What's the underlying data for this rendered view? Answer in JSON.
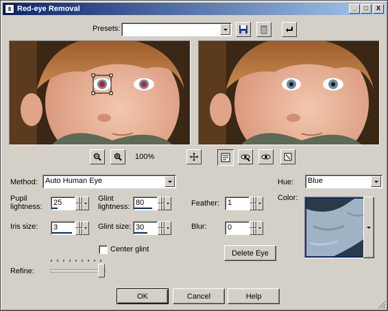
{
  "window": {
    "title": "Red-eye Removal",
    "app_icon_glyph": "8"
  },
  "titlebar": {
    "minimize": "_",
    "maximize": "□",
    "close": "X"
  },
  "presets": {
    "label": "Presets:",
    "value": ""
  },
  "zoom": {
    "level": "100%"
  },
  "method": {
    "label": "Method:",
    "value": "Auto Human Eye"
  },
  "pupil_lightness": {
    "label_line1": "Pupil",
    "label_line2": "lightness:",
    "value": "25",
    "level": 0.25
  },
  "glint_lightness": {
    "label_line1": "Glint",
    "label_line2": "lightness:",
    "value": "80",
    "level": 0.8
  },
  "iris_size": {
    "label": "Iris size:",
    "value": "3",
    "level": 0.9
  },
  "glint_size": {
    "label": "Glint size:",
    "value": "30",
    "level": 0.6
  },
  "feather": {
    "label": "Feather:",
    "value": "1",
    "level": 0.0
  },
  "blur": {
    "label": "Blur:",
    "value": "0",
    "level": 0.0
  },
  "center_glint": {
    "label": "Center glint",
    "checked": false
  },
  "delete_eye": {
    "label": "Delete Eye"
  },
  "hue": {
    "label": "Hue:",
    "value": "Blue"
  },
  "color": {
    "label": "Color:"
  },
  "refine": {
    "label": "Refine:",
    "level": 1.0
  },
  "buttons": {
    "ok": "OK",
    "cancel": "Cancel",
    "help": "Help"
  },
  "colors": {
    "titlebar_start": "#0a246a",
    "titlebar_end": "#a6caf0",
    "face": "#d4d0c8",
    "iris_swatch": "#9fb3c5"
  },
  "icons": {
    "save": "floppy-icon",
    "delete": "trash-icon",
    "reset": "undo-arrow-icon",
    "zoom_out": "zoom-out-icon",
    "zoom_in": "zoom-in-icon",
    "pan": "pan-icon",
    "proof": "proof-icon",
    "eye_tool": "eye-tool-icon",
    "eye": "eye-icon",
    "randomize": "dice-icon"
  }
}
